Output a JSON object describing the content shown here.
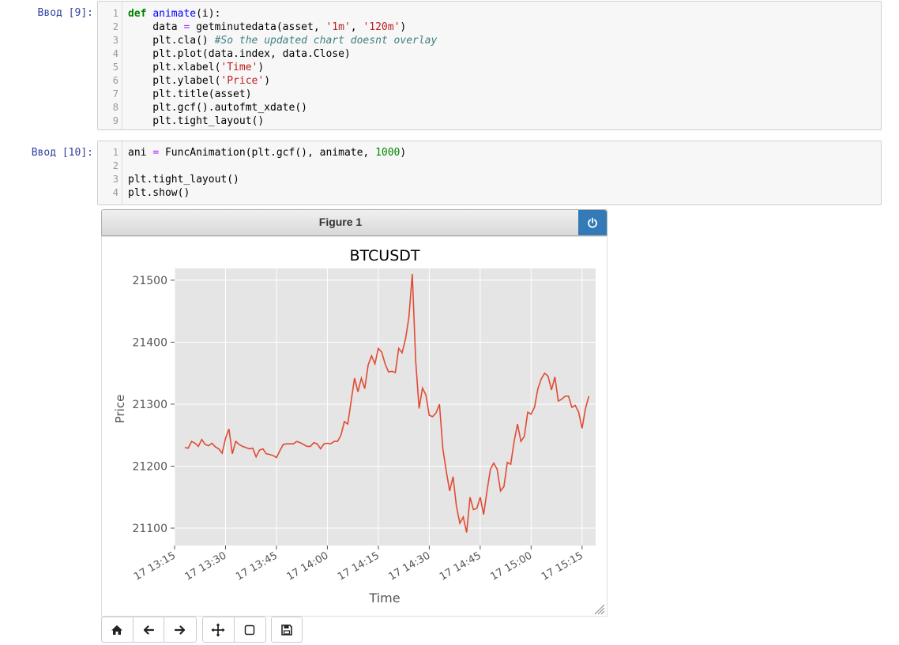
{
  "cells": [
    {
      "prompt": "Ввод [9]:",
      "lines": [
        {
          "n": "1",
          "code": [
            [
              "kw",
              "def "
            ],
            [
              "fn",
              "animate"
            ],
            [
              "",
              "(i):"
            ]
          ]
        },
        {
          "n": "2",
          "code": [
            [
              "",
              "    data "
            ],
            [
              "op",
              "="
            ],
            [
              "",
              " getminutedata(asset, "
            ],
            [
              "str",
              "'1m'"
            ],
            [
              "",
              ", "
            ],
            [
              "str",
              "'120m'"
            ],
            [
              "",
              ")"
            ]
          ]
        },
        {
          "n": "3",
          "code": [
            [
              "",
              "    plt.cla() "
            ],
            [
              "cmt",
              "#So the updated chart doesnt overlay"
            ]
          ]
        },
        {
          "n": "4",
          "code": [
            [
              "",
              "    plt.plot(data.index, data.Close)"
            ]
          ]
        },
        {
          "n": "5",
          "code": [
            [
              "",
              "    plt.xlabel("
            ],
            [
              "str",
              "'Time'"
            ],
            [
              "",
              ")"
            ]
          ]
        },
        {
          "n": "6",
          "code": [
            [
              "",
              "    plt.ylabel("
            ],
            [
              "str",
              "'Price'"
            ],
            [
              "",
              ")"
            ]
          ]
        },
        {
          "n": "7",
          "code": [
            [
              "",
              "    plt.title(asset)"
            ]
          ]
        },
        {
          "n": "8",
          "code": [
            [
              "",
              "    plt.gcf().autofmt_xdate()"
            ]
          ]
        },
        {
          "n": "9",
          "code": [
            [
              "",
              "    plt.tight_layout()"
            ]
          ]
        }
      ]
    },
    {
      "prompt": "Ввод [10]:",
      "lines": [
        {
          "n": "1",
          "code": [
            [
              "",
              "ani "
            ],
            [
              "op",
              "="
            ],
            [
              "",
              " FuncAnimation(plt.gcf(), animate, "
            ],
            [
              "num",
              "1000"
            ],
            [
              "",
              ")"
            ]
          ]
        },
        {
          "n": "2",
          "code": [
            [
              "",
              ""
            ]
          ]
        },
        {
          "n": "3",
          "code": [
            [
              "",
              "plt.tight_layout()"
            ]
          ]
        },
        {
          "n": "4",
          "code": [
            [
              "",
              "plt.show()"
            ]
          ]
        }
      ]
    }
  ],
  "figure": {
    "header_title": "Figure 1",
    "power_icon": "power-icon",
    "toolbar": [
      [
        "home-icon",
        "back-arrow-icon",
        "forward-arrow-icon"
      ],
      [
        "pan-move-icon",
        "zoom-rect-icon"
      ],
      [
        "save-disk-icon"
      ]
    ]
  },
  "colors": {
    "line": "#e24a33",
    "axes_bg": "#e5e5e5",
    "grid": "#ffffff",
    "power_btn": "#337ab7"
  },
  "chart_data": {
    "type": "line",
    "title": "BTCUSDT",
    "xlabel": "Time",
    "ylabel": "Price",
    "x_start": "17 13:18",
    "x_step_minutes": 1,
    "x_ticks": [
      "17 13:15",
      "17 13:30",
      "17 13:45",
      "17 14:00",
      "17 14:15",
      "17 14:30",
      "17 14:45",
      "17 15:00",
      "17 15:15"
    ],
    "y_ticks": [
      21100,
      21200,
      21300,
      21400,
      21500
    ],
    "xlim_minutes": [
      -3,
      121
    ],
    "ylim": [
      21072,
      21519
    ],
    "grid": true,
    "values": [
      21230,
      21229,
      21240,
      21237,
      21232,
      21243,
      21235,
      21233,
      21237,
      21231,
      21228,
      21221,
      21245,
      21260,
      21220,
      21240,
      21235,
      21232,
      21230,
      21228,
      21229,
      21215,
      21226,
      21228,
      21220,
      21219,
      21217,
      21214,
      21225,
      21235,
      21236,
      21236,
      21236,
      21240,
      21238,
      21235,
      21232,
      21232,
      21238,
      21236,
      21228,
      21236,
      21237,
      21236,
      21240,
      21240,
      21250,
      21272,
      21268,
      21305,
      21342,
      21320,
      21342,
      21325,
      21363,
      21378,
      21365,
      21390,
      21384,
      21365,
      21352,
      21353,
      21351,
      21390,
      21383,
      21405,
      21440,
      21510,
      21370,
      21293,
      21326,
      21315,
      21282,
      21280,
      21286,
      21300,
      21228,
      21192,
      21160,
      21183,
      21135,
      21108,
      21118,
      21093,
      21150,
      21130,
      21132,
      21150,
      21122,
      21160,
      21195,
      21205,
      21195,
      21160,
      21167,
      21206,
      21203,
      21240,
      21268,
      21240,
      21248,
      21287,
      21284,
      21295,
      21325,
      21341,
      21350,
      21345,
      21323,
      21344,
      21305,
      21308,
      21313,
      21313,
      21295,
      21298,
      21287,
      21261,
      21293,
      21313
    ]
  }
}
